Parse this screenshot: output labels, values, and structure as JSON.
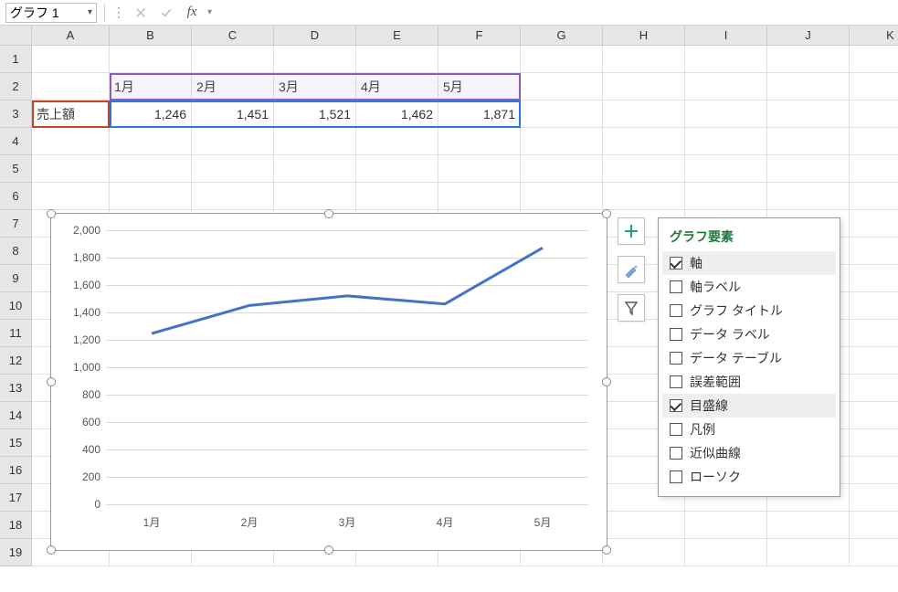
{
  "namebox": "グラフ 1",
  "columns": [
    "A",
    "B",
    "C",
    "D",
    "E",
    "F",
    "G",
    "H",
    "I",
    "J",
    "K"
  ],
  "rows": [
    "1",
    "2",
    "3",
    "4",
    "5",
    "6",
    "7",
    "8",
    "9",
    "10",
    "11",
    "12",
    "13",
    "14",
    "15",
    "16",
    "17",
    "18",
    "19"
  ],
  "table": {
    "rowLabel": "売上額",
    "headers": [
      "1月",
      "2月",
      "3月",
      "4月",
      "5月"
    ],
    "values": [
      "1,246",
      "1,451",
      "1,521",
      "1,462",
      "1,871"
    ]
  },
  "chart_data": {
    "type": "line",
    "categories": [
      "1月",
      "2月",
      "3月",
      "4月",
      "5月"
    ],
    "series": [
      {
        "name": "売上額",
        "values": [
          1246,
          1451,
          1521,
          1462,
          1871
        ]
      }
    ],
    "y_ticks": [
      0,
      200,
      400,
      600,
      800,
      1000,
      1200,
      1400,
      1600,
      1800,
      2000
    ],
    "ylim": [
      0,
      2000
    ],
    "title": "",
    "xlabel": "",
    "ylabel": ""
  },
  "chart_elements": {
    "title": "グラフ要素",
    "items": [
      {
        "label": "軸",
        "checked": true,
        "hover": true
      },
      {
        "label": "軸ラベル",
        "checked": false
      },
      {
        "label": "グラフ タイトル",
        "checked": false
      },
      {
        "label": "データ ラベル",
        "checked": false
      },
      {
        "label": "データ テーブル",
        "checked": false
      },
      {
        "label": "誤差範囲",
        "checked": false
      },
      {
        "label": "目盛線",
        "checked": true,
        "hover": true
      },
      {
        "label": "凡例",
        "checked": false
      },
      {
        "label": "近似曲線",
        "checked": false
      },
      {
        "label": "ローソク",
        "checked": false
      }
    ]
  }
}
